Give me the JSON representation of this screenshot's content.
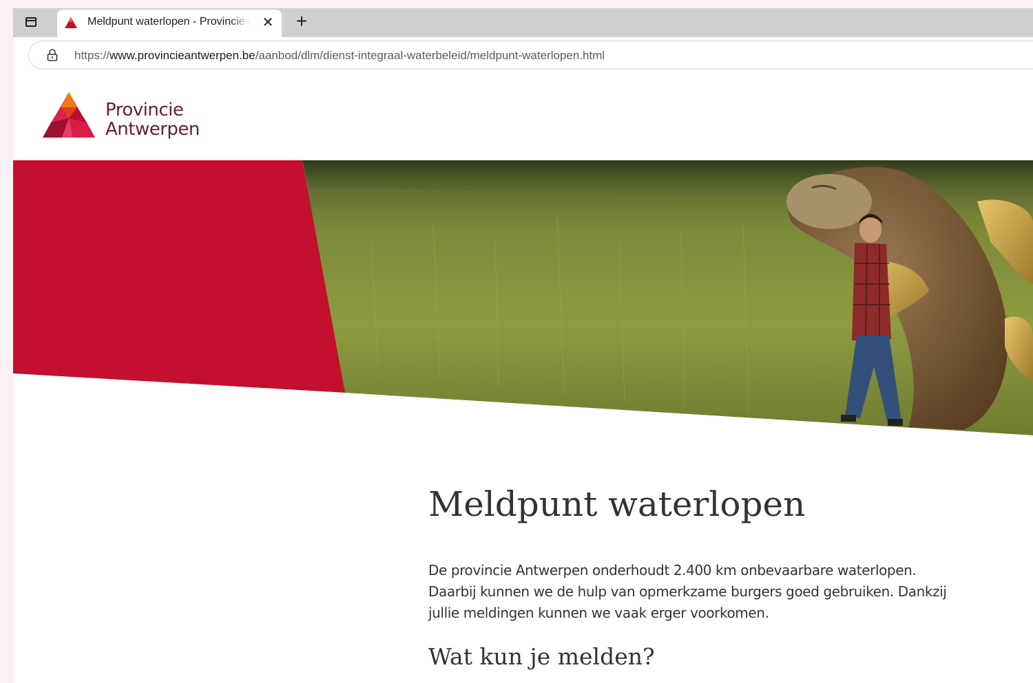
{
  "browser": {
    "tab": {
      "title": "Meldpunt waterlopen - Provincie Antwerpen",
      "close_glyph": "✕",
      "favicon": "provincie-antwerpen-triangle-icon"
    },
    "new_tab_glyph": "+",
    "address": {
      "scheme": "https://",
      "host": "www.provincieantwerpen.be",
      "path": "/aanbod/dlm/dienst-integraal-waterbeleid/meldpunt-waterlopen.html"
    }
  },
  "site": {
    "logo": {
      "line1": "Provincie",
      "line2": "Antwerpen"
    },
    "colors": {
      "brand_red": "#c4102f",
      "logo_text": "#6b1d2d"
    }
  },
  "hero": {
    "image": "field-with-man-hugging-giant-fish-creature-illustration"
  },
  "content": {
    "title": "Meldpunt waterlopen",
    "intro": "De provincie Antwerpen onderhoudt 2.400 km onbevaarbare waterlopen. Daarbij kunnen we de hulp van opmerkzame burgers goed gebruiken. Dankzij jullie meldingen kunnen we vaak erger voorkomen.",
    "subheading": "Wat kun je melden?"
  }
}
